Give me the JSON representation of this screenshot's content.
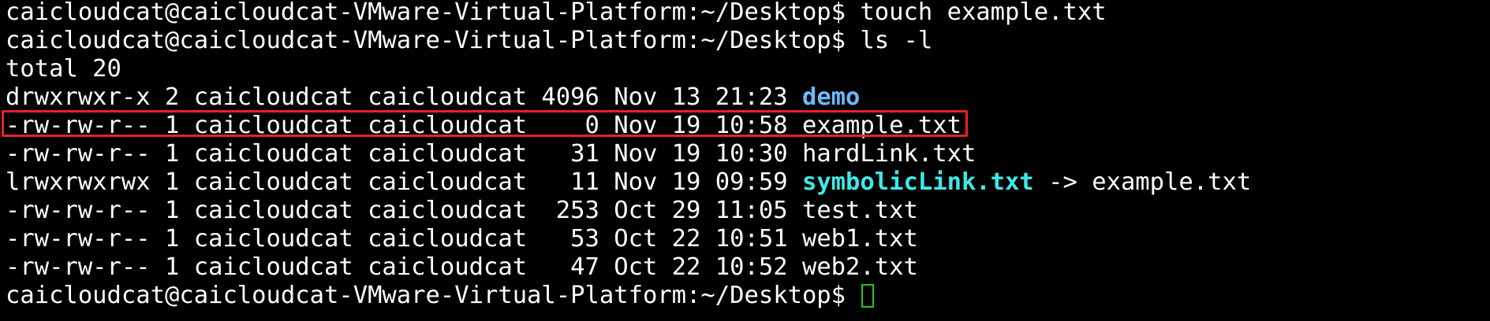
{
  "terminal": {
    "prompt": "caicloudcat@caicloudcat-VMware-Virtual-Platform:~/Desktop$",
    "commands": [
      "touch example.txt",
      "ls -l"
    ],
    "total_line": "total 20",
    "listing": [
      {
        "meta": "drwxrwxr-x 2 caicloudcat caicloudcat 4096 Nov 13 21:23 ",
        "name": "demo",
        "target": ""
      },
      {
        "meta": "-rw-rw-r-- 1 caicloudcat caicloudcat    0 Nov 19 10:58 ",
        "name": "example.txt",
        "target": ""
      },
      {
        "meta": "-rw-rw-r-- 1 caicloudcat caicloudcat   31 Nov 19 10:30 ",
        "name": "hardLink.txt",
        "target": ""
      },
      {
        "meta": "lrwxrwxrwx 1 caicloudcat caicloudcat   11 Nov 19 09:59 ",
        "name": "symbolicLink.txt",
        "target": " -> example.txt"
      },
      {
        "meta": "-rw-rw-r-- 1 caicloudcat caicloudcat  253 Oct 29 11:05 ",
        "name": "test.txt",
        "target": ""
      },
      {
        "meta": "-rw-rw-r-- 1 caicloudcat caicloudcat   53 Oct 22 10:51 ",
        "name": "web1.txt",
        "target": ""
      },
      {
        "meta": "-rw-rw-r-- 1 caicloudcat caicloudcat   47 Oct 22 10:52 ",
        "name": "web2.txt",
        "target": ""
      }
    ]
  },
  "colors": {
    "background": "#000000",
    "text": "#ffffff",
    "directory": "#6db8ff",
    "symlink": "#3fe8e8",
    "highlight_border": "#e8202a",
    "cursor": "#26c426"
  }
}
